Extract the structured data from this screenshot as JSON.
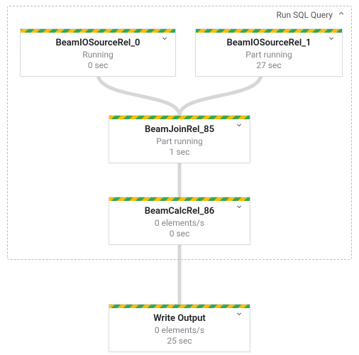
{
  "group": {
    "label": "Run SQL Query",
    "collapse_icon": "chevron-up"
  },
  "nodes": {
    "src0": {
      "title": "BeamIOSourceRel_0",
      "status": "Running",
      "metric": "0 sec"
    },
    "src1": {
      "title": "BeamIOSourceRel_1",
      "status": "Part running",
      "metric": "27 sec"
    },
    "join": {
      "title": "BeamJoinRel_85",
      "status": "Part running",
      "metric": "1 sec"
    },
    "calc": {
      "title": "BeamCalcRel_86",
      "status": "0 elements/s",
      "metric": "0 sec"
    },
    "write": {
      "title": "Write Output",
      "status": "0 elements/s",
      "metric": "25 sec"
    }
  },
  "chevron_down": "⌄"
}
